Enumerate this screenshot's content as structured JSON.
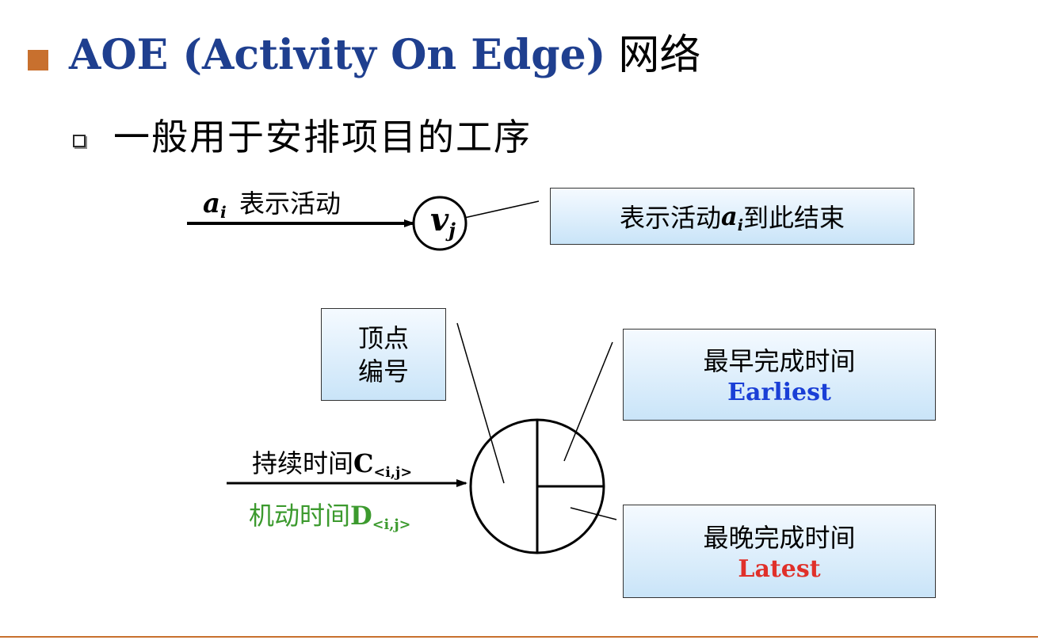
{
  "title": {
    "en": "AOE (Activity On Edge)",
    "cn": "网络"
  },
  "subtitle": "一般用于安排项目的工序",
  "diagram_top": {
    "edge_label_var": "a",
    "edge_label_sub": "i",
    "edge_label_text": "表示活动",
    "node_var": "v",
    "node_sub": "j",
    "callout_text_before": "表示活动",
    "callout_var": "a",
    "callout_sub": "i",
    "callout_text_after": "到此结束"
  },
  "diagram_bottom": {
    "vertex_box_line1": "顶点",
    "vertex_box_line2": "编号",
    "earliest_title": "最早完成时间",
    "earliest_label": "Earliest",
    "latest_title": "最晚完成时间",
    "latest_label": "Latest",
    "duration_text": "持续时间",
    "duration_var": "C",
    "duration_sub": "<i,j>",
    "slack_text": "机动时间",
    "slack_var": "D",
    "slack_sub": "<i,j>"
  },
  "colors": {
    "title_en": "#1f3f8f",
    "accent_orange": "#c8702e",
    "earliest_blue": "#1a3fd6",
    "latest_red": "#e0302a",
    "slack_green": "#3c9a2e"
  }
}
